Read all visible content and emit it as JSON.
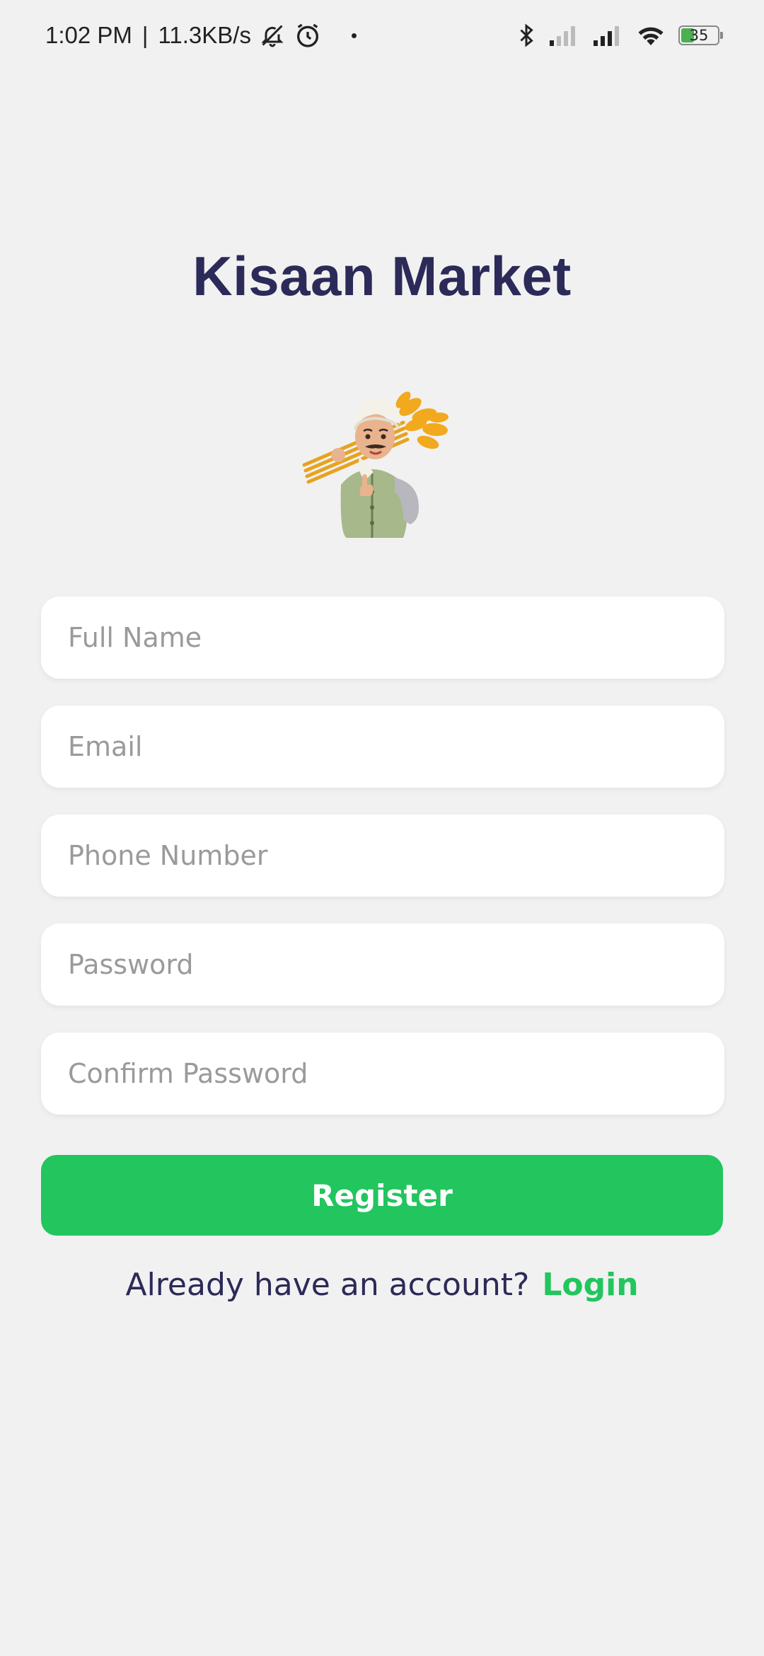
{
  "status_bar": {
    "time": "1:02 PM",
    "separator": "|",
    "network_speed": "11.3KB/s",
    "battery_level": "35",
    "battery_fraction": 0.35,
    "icons": [
      "bell-off-icon",
      "alarm-icon",
      "bluetooth-icon",
      "signal-icon",
      "signal-icon",
      "wifi-icon",
      "battery-icon"
    ]
  },
  "app": {
    "title": "Kisaan Market",
    "illustration": "farmer-with-wheat-icon"
  },
  "form": {
    "full_name_placeholder": "Full Name",
    "email_placeholder": "Email",
    "phone_placeholder": "Phone Number",
    "password_placeholder": "Password",
    "confirm_password_placeholder": "Confirm Password",
    "register_label": "Register"
  },
  "footer": {
    "prompt": "Already have an account?",
    "login_label": "Login"
  },
  "colors": {
    "background": "#f1f1f1",
    "title": "#2b2a58",
    "accent": "#22c55e",
    "field_bg": "#ffffff",
    "placeholder": "#9a9a9a"
  }
}
